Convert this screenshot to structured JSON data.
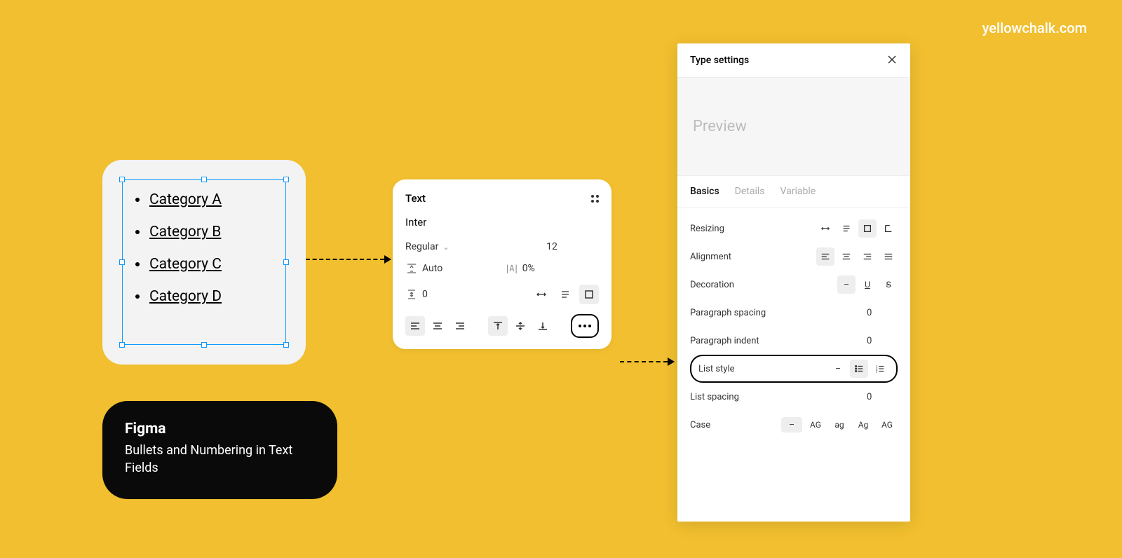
{
  "watermark": "yellowchalk.com",
  "canvas": {
    "items": [
      "Category A",
      "Category B",
      "Category C",
      "Category D"
    ]
  },
  "caption": {
    "title": "Figma",
    "subtitle": "Bullets and Numbering in Text Fields"
  },
  "text_panel": {
    "title": "Text",
    "font_family": "Inter",
    "font_weight": "Regular",
    "font_size": "12",
    "line_height": "Auto",
    "letter_spacing": "0%",
    "paragraph_spacing": "0"
  },
  "type_panel": {
    "title": "Type settings",
    "preview_label": "Preview",
    "tabs": [
      "Basics",
      "Details",
      "Variable"
    ],
    "active_tab": 0,
    "rows": {
      "resizing": "Resizing",
      "alignment": "Alignment",
      "decoration": "Decoration",
      "paragraph_spacing": "Paragraph spacing",
      "paragraph_spacing_val": "0",
      "paragraph_indent": "Paragraph indent",
      "paragraph_indent_val": "0",
      "list_style": "List style",
      "list_spacing": "List spacing",
      "list_spacing_val": "0",
      "case": "Case"
    },
    "decoration_none": "–",
    "decoration_underline": "U",
    "decoration_strike": "S",
    "list_none": "–",
    "case_options": [
      "–",
      "AG",
      "ag",
      "Ag",
      "AG"
    ]
  }
}
